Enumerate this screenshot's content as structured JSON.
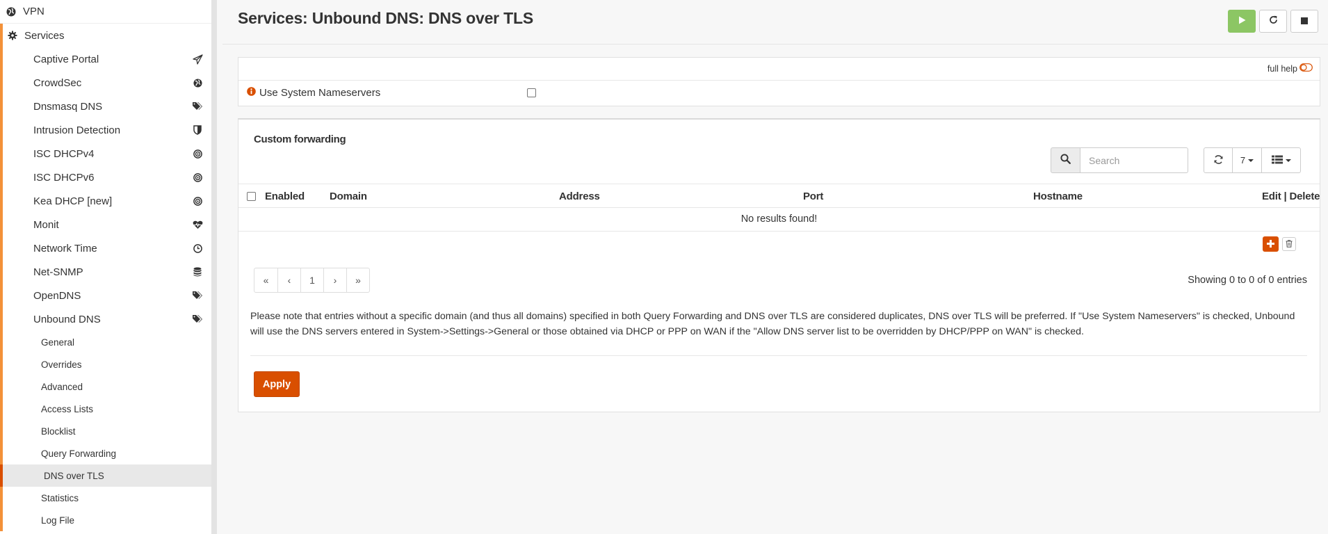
{
  "sidebar": {
    "top_items": [
      {
        "label": "VPN",
        "icon": "globe-icon"
      },
      {
        "label": "Services",
        "icon": "gear-icon"
      }
    ],
    "services_items": [
      {
        "label": "Captive Portal",
        "icon": "paper-plane-icon"
      },
      {
        "label": "CrowdSec",
        "icon": "globe-icon"
      },
      {
        "label": "Dnsmasq DNS",
        "icon": "tags-icon"
      },
      {
        "label": "Intrusion Detection",
        "icon": "shield-icon"
      },
      {
        "label": "ISC DHCPv4",
        "icon": "bullseye-icon"
      },
      {
        "label": "ISC DHCPv6",
        "icon": "bullseye-icon"
      },
      {
        "label": "Kea DHCP [new]",
        "icon": "bullseye-icon"
      },
      {
        "label": "Monit",
        "icon": "heartbeat-icon"
      },
      {
        "label": "Network Time",
        "icon": "clock-icon"
      },
      {
        "label": "Net-SNMP",
        "icon": "database-icon"
      },
      {
        "label": "OpenDNS",
        "icon": "tags-icon"
      },
      {
        "label": "Unbound DNS",
        "icon": "tags-icon"
      }
    ],
    "unbound_subitems": [
      {
        "label": "General"
      },
      {
        "label": "Overrides"
      },
      {
        "label": "Advanced"
      },
      {
        "label": "Access Lists"
      },
      {
        "label": "Blocklist"
      },
      {
        "label": "Query Forwarding"
      },
      {
        "label": "DNS over TLS",
        "active": true
      },
      {
        "label": "Statistics"
      },
      {
        "label": "Log File"
      }
    ]
  },
  "header": {
    "title": "Services: Unbound DNS: DNS over TLS",
    "service_buttons": [
      "play-icon",
      "refresh-icon",
      "stop-icon"
    ]
  },
  "general": {
    "full_help": "full help",
    "use_system_nameservers_label": "Use System Nameservers",
    "use_system_nameservers_checked": false
  },
  "forwarding": {
    "title": "Custom forwarding",
    "search_placeholder": "Search",
    "rows_per_page": "7",
    "columns": [
      "Enabled",
      "Domain",
      "Address",
      "Port",
      "Hostname",
      "Edit | Delete"
    ],
    "empty_message": "No results found!",
    "pagination": [
      "«",
      "‹",
      "1",
      "›",
      "»"
    ],
    "showing": "Showing 0 to 0 of 0 entries"
  },
  "note": "Please note that entries without a specific domain (and thus all domains) specified in both Query Forwarding and DNS over TLS are considered duplicates, DNS over TLS will be preferred. If \"Use System Nameservers\" is checked, Unbound will use the DNS servers entered in System->Settings->General or those obtained via DHCP or PPP on WAN if the \"Allow DNS server list to be overridden by DHCP/PPP on WAN\" is checked.",
  "apply_label": "Apply",
  "colors": {
    "accent": "#d94f00",
    "sidebar_accent": "#f39139",
    "play_green": "#8cc664"
  }
}
